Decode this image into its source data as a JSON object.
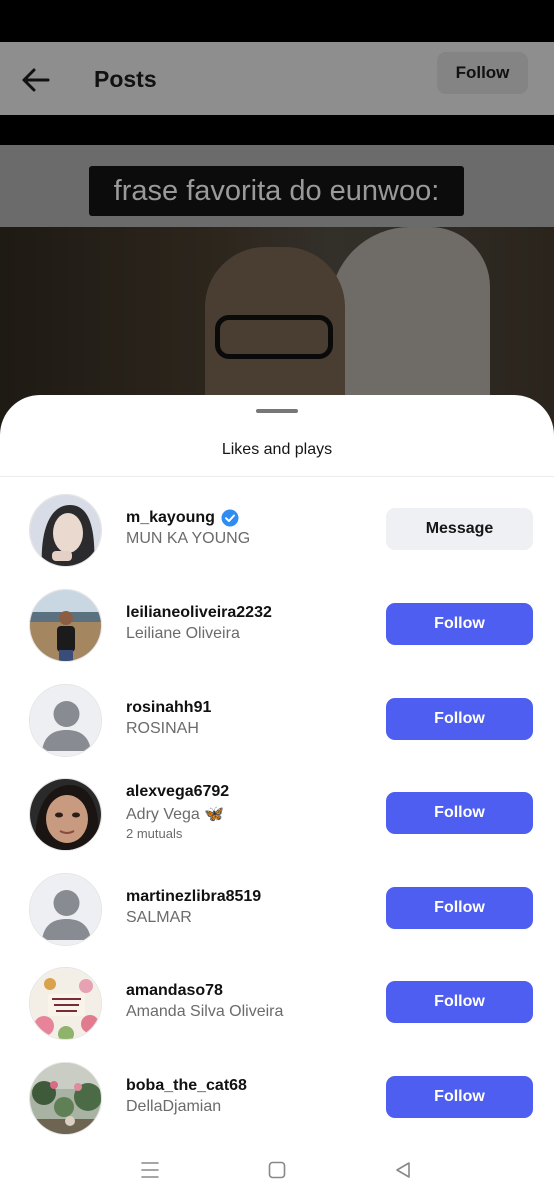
{
  "header": {
    "title": "Posts",
    "follow_label": "Follow"
  },
  "video": {
    "caption": "frase favorita do eunwoo:"
  },
  "sheet": {
    "title": "Likes and plays"
  },
  "users": [
    {
      "username": "m_kayoung",
      "fullname": "MUN KA YOUNG",
      "verified": true,
      "action": "Message",
      "mutuals": ""
    },
    {
      "username": "leilianeoliveira2232",
      "fullname": "Leiliane Oliveira",
      "verified": false,
      "action": "Follow",
      "mutuals": ""
    },
    {
      "username": "rosinahh91",
      "fullname": "ROSINAH",
      "verified": false,
      "action": "Follow",
      "mutuals": ""
    },
    {
      "username": "alexvega6792",
      "fullname": "Adry Vega 🦋",
      "verified": false,
      "action": "Follow",
      "mutuals": "2 mutuals"
    },
    {
      "username": "martinezlibra8519",
      "fullname": "SALMAR",
      "verified": false,
      "action": "Follow",
      "mutuals": ""
    },
    {
      "username": "amandaso78",
      "fullname": "Amanda Silva Oliveira",
      "verified": false,
      "action": "Follow",
      "mutuals": ""
    },
    {
      "username": "boba_the_cat68",
      "fullname": "DellaDjamian",
      "verified": false,
      "action": "Follow",
      "mutuals": ""
    }
  ],
  "colors": {
    "follow_button": "#4d5ef0",
    "message_button": "#eff0f4",
    "verified_badge": "#2f8cf0"
  },
  "icons": {
    "back": "arrow-left-icon",
    "verified": "verified-badge-icon",
    "nav_menu": "menu-icon",
    "nav_home": "square-icon",
    "nav_back": "triangle-back-icon"
  }
}
